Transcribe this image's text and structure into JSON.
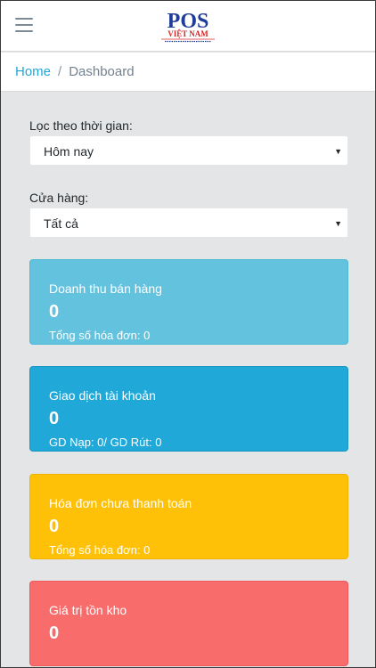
{
  "header": {
    "menu_icon": "hamburger-icon",
    "logo": {
      "text_main": "POS",
      "text_sub": "VIỆT NAM"
    }
  },
  "breadcrumb": {
    "home": "Home",
    "separator": "/",
    "current": "Dashboard"
  },
  "filters": {
    "time": {
      "label": "Lọc theo thời gian:",
      "value": "Hôm nay"
    },
    "store": {
      "label": "Cửa hàng:",
      "value": "Tất cả"
    }
  },
  "cards": [
    {
      "title": "Doanh thu bán hàng",
      "value": "0",
      "sub": "Tổng số hóa đơn: 0",
      "color": "#63c2de"
    },
    {
      "title": "Giao dịch tài khoản",
      "value": "0",
      "sub": "GD Nạp: 0/ GD Rút: 0",
      "color": "#20a8d8"
    },
    {
      "title": "Hóa đơn chưa thanh toán",
      "value": "0",
      "sub": "Tổng số hóa đơn: 0",
      "color": "#ffc107"
    },
    {
      "title": "Giá trị tồn kho",
      "value": "0",
      "color": "#f86c6b"
    }
  ],
  "colors": {
    "link": "#20a8d8",
    "background": "#e4e5e6"
  }
}
